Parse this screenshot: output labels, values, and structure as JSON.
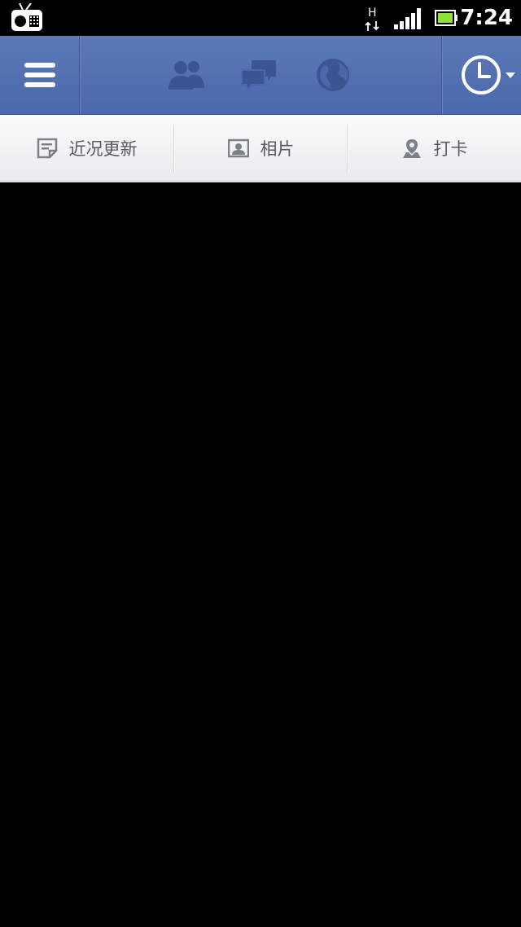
{
  "status_bar": {
    "time": "7:24",
    "network_type": "H"
  },
  "header": {
    "menu_icon": "hamburger-menu-icon",
    "jewels": [
      "friend-requests-icon",
      "messages-icon",
      "notifications-globe-icon"
    ],
    "timeline_icon": "clock-icon"
  },
  "publisher": {
    "status_label": "近况更新",
    "photo_label": "相片",
    "checkin_label": "打卡"
  },
  "colors": {
    "header_blue": "#4a68ab",
    "jewel_dark": "#3a5592"
  }
}
